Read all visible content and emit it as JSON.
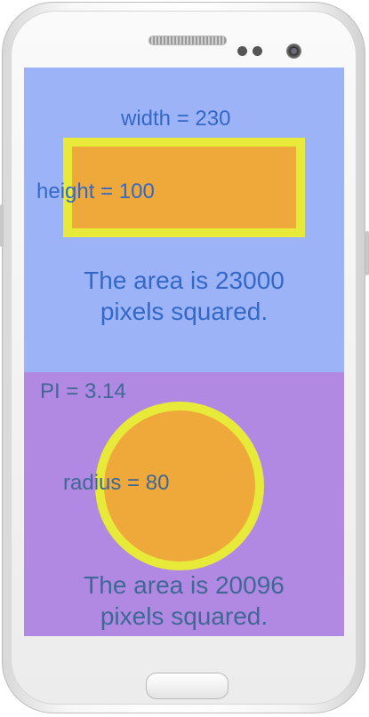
{
  "colors": {
    "top_panel_bg": "#9cb4f7",
    "bottom_panel_bg": "#b289e2",
    "shape_fill": "#efa83a",
    "shape_stroke": "#e8ea3a",
    "top_text": "#3468c8",
    "bottom_text": "#3f6896"
  },
  "rectangle": {
    "width_label": "width = 230",
    "height_label": "height = 100",
    "area_line1": "The area is 23000",
    "area_line2": "pixels squared."
  },
  "circle": {
    "pi_label": "PI = 3.14",
    "radius_label": "radius = 80",
    "area_line1": "The area is 20096",
    "area_line2": "pixels squared."
  }
}
